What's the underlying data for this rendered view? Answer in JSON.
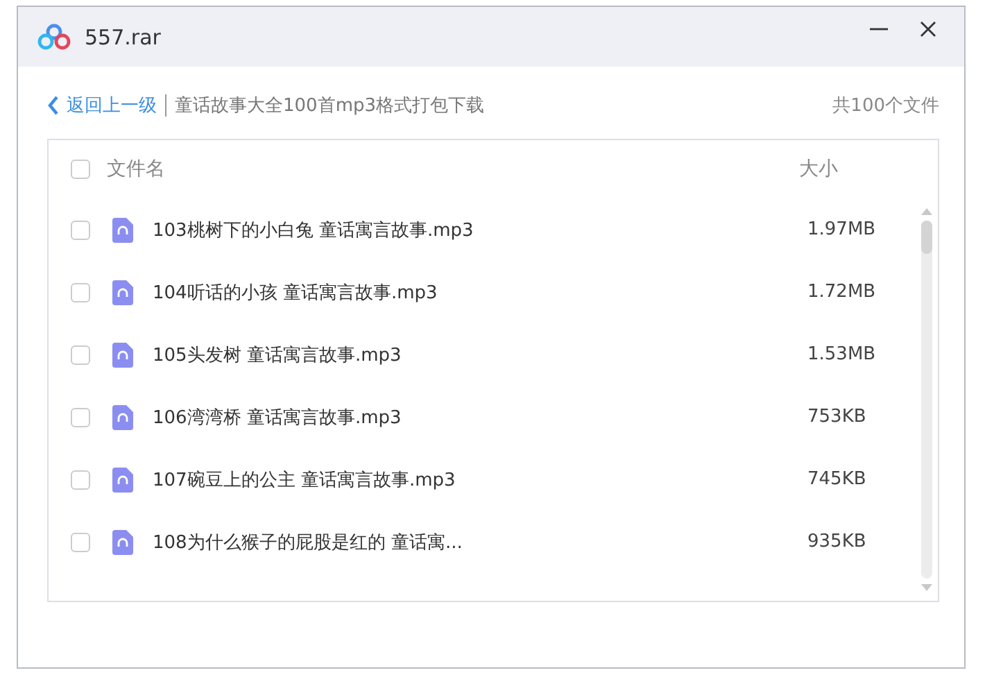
{
  "window": {
    "title": "557.rar"
  },
  "nav": {
    "back": "返回上一级",
    "path": "童话故事大全100首mp3格式打包下载",
    "count": "共100个文件"
  },
  "table": {
    "select_all": {
      "checked": false
    },
    "columns": [
      "文件名",
      "大小"
    ],
    "rows": [
      {
        "name": "103桃树下的小白兔 童话寓言故事.mp3",
        "size": "1.97MB",
        "checked": false
      },
      {
        "name": "104听话的小孩 童话寓言故事.mp3",
        "size": "1.72MB",
        "checked": false
      },
      {
        "name": "105头发树 童话寓言故事.mp3",
        "size": "1.53MB",
        "checked": false
      },
      {
        "name": "106湾湾桥 童话寓言故事.mp3",
        "size": "753KB",
        "checked": false
      },
      {
        "name": "107碗豆上的公主 童话寓言故事.mp3",
        "size": "745KB",
        "checked": false
      },
      {
        "name": "108为什么猴子的屁股是红的 童话寓...",
        "size": "935KB",
        "checked": false
      }
    ]
  }
}
